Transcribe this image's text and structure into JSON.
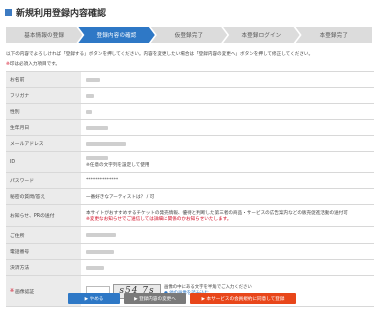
{
  "header": {
    "title": "新規利用登録内容確認"
  },
  "steps": [
    "基本情報の登録",
    "登録内容の確認",
    "仮登録完了",
    "本登録ログイン",
    "本登録完了"
  ],
  "intro": "以下の内容でよろしければ「登録する」ボタンを押してください。内容を変更したい場合は「登録内容の変更へ」ボタンを押して修正してください。",
  "required_note": {
    "mark": "※",
    "text": "印は必須入力項目です。"
  },
  "rows": [
    {
      "label": "お名前"
    },
    {
      "label": "フリガナ"
    },
    {
      "label": "性別"
    },
    {
      "label": "生年月日"
    },
    {
      "label": "メールアドレス"
    },
    {
      "label": "ID",
      "note": "※任意の文字列を設定して使用"
    },
    {
      "label": "パスワード",
      "value": "**************"
    },
    {
      "label": "秘密の質問/答え",
      "value": "一番好きなアーティストは？ / 可"
    },
    {
      "label": "お知らせ、PRの送付",
      "line1": "本サイトがおすすめするチケットの発売情報、優待と判断した第三者の商品・サービスの広告案内などの販売促進活動の送付可",
      "line2": "※変更なお知らせでご送信しては詳細に関係のかお知らせいたします。"
    },
    {
      "label": "ご住所"
    },
    {
      "label": "電話番号"
    },
    {
      "label": "決済方法"
    },
    {
      "label": "画像認証",
      "required_mark": "※",
      "captcha_text": "s54 7s",
      "help1": "画像の中にある文字を半角でご入力ください",
      "help2": "他の画像を読み込む"
    }
  ],
  "buttons": {
    "back": "▶ やめる",
    "change": "▶ 登録内容の変更へ",
    "submit": "▶ 本サービスの会員規約に同意して登録"
  }
}
